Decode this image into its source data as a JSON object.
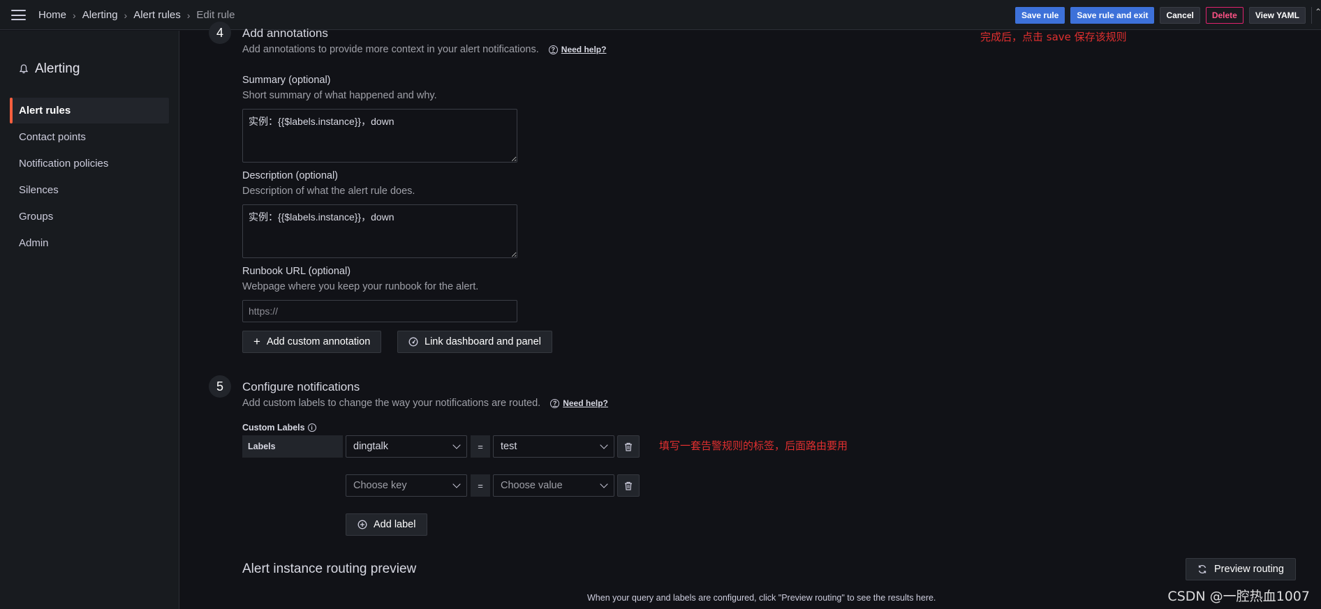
{
  "topbar": {
    "breadcrumb": [
      "Home",
      "Alerting",
      "Alert rules",
      "Edit rule"
    ],
    "actions": {
      "save_rule": "Save rule",
      "save_and_exit": "Save rule and exit",
      "cancel": "Cancel",
      "delete": "Delete",
      "view_yaml": "View YAML"
    }
  },
  "sidebar": {
    "title": "Alerting",
    "items": [
      {
        "label": "Alert rules",
        "active": true
      },
      {
        "label": "Contact points"
      },
      {
        "label": "Notification policies"
      },
      {
        "label": "Silences"
      },
      {
        "label": "Groups"
      },
      {
        "label": "Admin"
      }
    ]
  },
  "section4": {
    "number": "4",
    "title": "Add annotations",
    "description": "Add annotations to provide more context in your alert notifications.",
    "need_help": "Need help?",
    "summary": {
      "label": "Summary (optional)",
      "description": "Short summary of what happened and why.",
      "value": "实例：{{$labels.instance}}，down"
    },
    "description_field": {
      "label": "Description (optional)",
      "description": "Description of what the alert rule does.",
      "value": "实例：{{$labels.instance}}，down"
    },
    "runbook": {
      "label": "Runbook URL (optional)",
      "description": "Webpage where you keep your runbook for the alert.",
      "placeholder": "https://"
    },
    "add_custom_annotation": "Add custom annotation",
    "link_dashboard": "Link dashboard and panel"
  },
  "section5": {
    "number": "5",
    "title": "Configure notifications",
    "description": "Add custom labels to change the way your notifications are routed.",
    "need_help": "Need help?",
    "custom_labels_title": "Custom Labels",
    "labels_box": "Labels",
    "rows": [
      {
        "key": "dingtalk",
        "value": "test"
      },
      {
        "key_placeholder": "Choose key",
        "value_placeholder": "Choose value"
      }
    ],
    "equals": "=",
    "add_label": "Add label",
    "routing_preview_title": "Alert instance routing preview",
    "preview_routing": "Preview routing",
    "routing_hint": "When your query and labels are configured, click \"Preview routing\" to see the results here."
  },
  "annotations": {
    "save_note": "完成后，点击 save 保存该规则",
    "label_note": "填写一套告警规则的标签，后面路由要用"
  },
  "watermark": "CSDN @一腔热血1007"
}
